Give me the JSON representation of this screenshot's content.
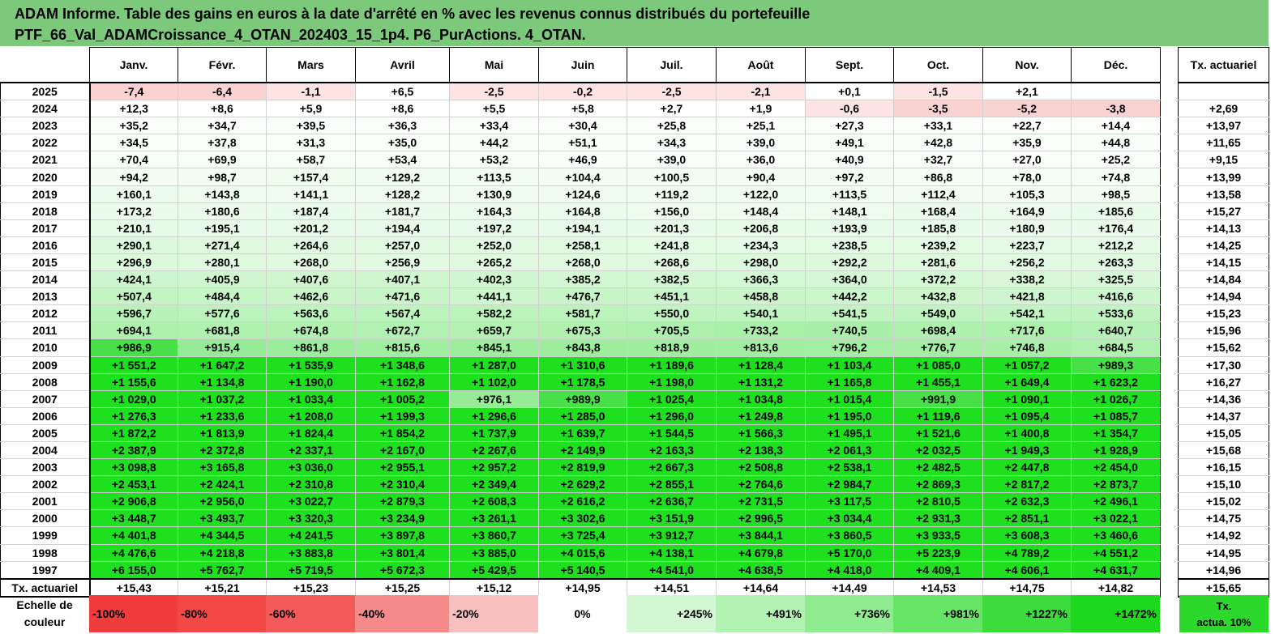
{
  "title": {
    "line1": "ADAM Informe. Table des gains en euros à la date d'arrêté en % avec les revenus connus distribués du portefeuille",
    "line2": "PTF_66_Val_ADAMCroissance_4_OTAN_202403_15_1p4. P6_PurActions. 4_OTAN."
  },
  "months": [
    "Janv.",
    "Févr.",
    "Mars",
    "Avril",
    "Mai",
    "Juin",
    "Juil.",
    "Août",
    "Sept.",
    "Oct.",
    "Nov.",
    "Déc."
  ],
  "tx_header": "Tx. actuariel",
  "rows": [
    {
      "year": "2025",
      "cells": [
        "-7,4",
        "-6,4",
        "-1,1",
        "+6,5",
        "-2,5",
        "-0,2",
        "-2,5",
        "-2,1",
        "+0,1",
        "-1,5",
        "+2,1",
        ""
      ],
      "tx": ""
    },
    {
      "year": "2024",
      "cells": [
        "+12,3",
        "+8,6",
        "+5,9",
        "+8,6",
        "+5,5",
        "+5,8",
        "+2,7",
        "+1,9",
        "-0,6",
        "-3,5",
        "-5,2",
        "-3,8"
      ],
      "tx": "+2,69"
    },
    {
      "year": "2023",
      "cells": [
        "+35,2",
        "+34,7",
        "+39,5",
        "+36,3",
        "+33,4",
        "+30,4",
        "+25,8",
        "+25,1",
        "+27,3",
        "+33,1",
        "+22,7",
        "+14,4"
      ],
      "tx": "+13,97"
    },
    {
      "year": "2022",
      "cells": [
        "+34,5",
        "+37,8",
        "+31,3",
        "+35,0",
        "+44,2",
        "+51,1",
        "+34,3",
        "+39,0",
        "+49,1",
        "+42,8",
        "+35,9",
        "+44,8"
      ],
      "tx": "+11,65"
    },
    {
      "year": "2021",
      "cells": [
        "+70,4",
        "+69,9",
        "+58,7",
        "+53,4",
        "+53,2",
        "+46,9",
        "+39,0",
        "+36,0",
        "+40,9",
        "+32,7",
        "+27,0",
        "+25,2"
      ],
      "tx": "+9,15"
    },
    {
      "year": "2020",
      "cells": [
        "+94,2",
        "+98,7",
        "+157,4",
        "+129,2",
        "+113,5",
        "+104,4",
        "+100,5",
        "+90,4",
        "+97,2",
        "+86,8",
        "+78,0",
        "+74,8"
      ],
      "tx": "+13,99"
    },
    {
      "year": "2019",
      "cells": [
        "+160,1",
        "+143,8",
        "+141,1",
        "+128,2",
        "+130,9",
        "+124,6",
        "+119,2",
        "+122,0",
        "+113,5",
        "+112,4",
        "+105,3",
        "+98,5"
      ],
      "tx": "+13,58"
    },
    {
      "year": "2018",
      "cells": [
        "+173,2",
        "+180,6",
        "+187,4",
        "+181,7",
        "+164,3",
        "+164,8",
        "+156,0",
        "+148,4",
        "+148,1",
        "+168,4",
        "+164,9",
        "+185,6"
      ],
      "tx": "+15,27"
    },
    {
      "year": "2017",
      "cells": [
        "+210,1",
        "+195,1",
        "+201,2",
        "+194,4",
        "+197,2",
        "+194,1",
        "+201,3",
        "+206,8",
        "+193,9",
        "+185,8",
        "+180,9",
        "+176,4"
      ],
      "tx": "+14,13"
    },
    {
      "year": "2016",
      "cells": [
        "+290,1",
        "+271,4",
        "+264,6",
        "+257,0",
        "+252,0",
        "+258,1",
        "+241,8",
        "+234,3",
        "+238,5",
        "+239,2",
        "+223,7",
        "+212,2"
      ],
      "tx": "+14,25"
    },
    {
      "year": "2015",
      "cells": [
        "+296,9",
        "+280,1",
        "+268,0",
        "+256,9",
        "+265,2",
        "+268,0",
        "+268,6",
        "+298,0",
        "+292,2",
        "+281,6",
        "+256,2",
        "+263,3"
      ],
      "tx": "+14,15"
    },
    {
      "year": "2014",
      "cells": [
        "+424,1",
        "+405,9",
        "+407,6",
        "+407,1",
        "+402,3",
        "+385,2",
        "+382,5",
        "+366,3",
        "+364,0",
        "+372,2",
        "+338,2",
        "+325,5"
      ],
      "tx": "+14,84"
    },
    {
      "year": "2013",
      "cells": [
        "+507,4",
        "+484,4",
        "+462,6",
        "+471,6",
        "+441,1",
        "+476,7",
        "+451,1",
        "+458,8",
        "+442,2",
        "+432,8",
        "+421,8",
        "+416,6"
      ],
      "tx": "+14,94"
    },
    {
      "year": "2012",
      "cells": [
        "+596,7",
        "+577,6",
        "+563,6",
        "+567,4",
        "+582,2",
        "+581,7",
        "+550,0",
        "+540,1",
        "+541,5",
        "+549,0",
        "+542,1",
        "+533,6"
      ],
      "tx": "+15,23"
    },
    {
      "year": "2011",
      "cells": [
        "+694,1",
        "+681,8",
        "+674,8",
        "+672,7",
        "+659,7",
        "+675,3",
        "+705,5",
        "+733,2",
        "+740,5",
        "+698,4",
        "+717,6",
        "+640,7"
      ],
      "tx": "+15,96"
    },
    {
      "year": "2010",
      "cells": [
        "+986,9",
        "+915,4",
        "+861,8",
        "+815,6",
        "+845,1",
        "+843,8",
        "+818,9",
        "+813,6",
        "+796,2",
        "+776,7",
        "+746,8",
        "+684,5"
      ],
      "tx": "+15,62"
    },
    {
      "year": "2009",
      "cells": [
        "+1 551,2",
        "+1 647,2",
        "+1 535,9",
        "+1 348,6",
        "+1 287,0",
        "+1 310,6",
        "+1 189,6",
        "+1 128,4",
        "+1 103,4",
        "+1 085,0",
        "+1 057,2",
        "+989,3"
      ],
      "tx": "+17,30"
    },
    {
      "year": "2008",
      "cells": [
        "+1 155,6",
        "+1 134,8",
        "+1 190,0",
        "+1 162,8",
        "+1 102,0",
        "+1 178,5",
        "+1 198,0",
        "+1 131,2",
        "+1 165,8",
        "+1 455,1",
        "+1 649,4",
        "+1 623,2"
      ],
      "tx": "+16,27"
    },
    {
      "year": "2007",
      "cells": [
        "+1 029,0",
        "+1 037,2",
        "+1 033,4",
        "+1 005,2",
        "+976,1",
        "+989,9",
        "+1 025,4",
        "+1 034,8",
        "+1 015,4",
        "+991,9",
        "+1 090,1",
        "+1 026,7"
      ],
      "tx": "+14,36"
    },
    {
      "year": "2006",
      "cells": [
        "+1 276,3",
        "+1 233,6",
        "+1 208,0",
        "+1 199,3",
        "+1 296,6",
        "+1 285,0",
        "+1 296,0",
        "+1 249,8",
        "+1 195,0",
        "+1 119,6",
        "+1 095,4",
        "+1 085,7"
      ],
      "tx": "+14,37"
    },
    {
      "year": "2005",
      "cells": [
        "+1 872,2",
        "+1 813,9",
        "+1 824,4",
        "+1 854,2",
        "+1 737,9",
        "+1 639,7",
        "+1 544,5",
        "+1 566,3",
        "+1 495,1",
        "+1 521,6",
        "+1 400,8",
        "+1 354,7"
      ],
      "tx": "+15,05"
    },
    {
      "year": "2004",
      "cells": [
        "+2 387,9",
        "+2 372,8",
        "+2 337,1",
        "+2 167,0",
        "+2 267,6",
        "+2 149,9",
        "+2 163,3",
        "+2 138,3",
        "+2 061,3",
        "+2 032,5",
        "+1 949,3",
        "+1 928,9"
      ],
      "tx": "+15,68"
    },
    {
      "year": "2003",
      "cells": [
        "+3 098,8",
        "+3 165,8",
        "+3 036,0",
        "+2 955,1",
        "+2 957,2",
        "+2 819,9",
        "+2 667,3",
        "+2 508,8",
        "+2 538,1",
        "+2 482,5",
        "+2 447,8",
        "+2 454,0"
      ],
      "tx": "+16,15"
    },
    {
      "year": "2002",
      "cells": [
        "+2 453,1",
        "+2 424,1",
        "+2 310,8",
        "+2 310,4",
        "+2 349,4",
        "+2 629,2",
        "+2 855,1",
        "+2 764,6",
        "+2 984,7",
        "+2 869,3",
        "+2 817,2",
        "+2 873,7"
      ],
      "tx": "+15,10"
    },
    {
      "year": "2001",
      "cells": [
        "+2 906,8",
        "+2 956,0",
        "+3 022,7",
        "+2 879,3",
        "+2 608,3",
        "+2 616,2",
        "+2 636,7",
        "+2 731,5",
        "+3 117,5",
        "+2 810,5",
        "+2 632,3",
        "+2 496,1"
      ],
      "tx": "+15,02"
    },
    {
      "year": "2000",
      "cells": [
        "+3 448,7",
        "+3 493,7",
        "+3 320,3",
        "+3 234,9",
        "+3 261,1",
        "+3 302,6",
        "+3 151,9",
        "+2 996,5",
        "+3 034,4",
        "+2 931,3",
        "+2 851,1",
        "+3 022,1"
      ],
      "tx": "+14,75"
    },
    {
      "year": "1999",
      "cells": [
        "+4 401,8",
        "+4 344,5",
        "+4 241,5",
        "+3 897,8",
        "+3 860,7",
        "+3 725,4",
        "+3 912,7",
        "+3 844,1",
        "+3 860,5",
        "+3 933,5",
        "+3 608,3",
        "+3 460,6"
      ],
      "tx": "+14,92"
    },
    {
      "year": "1998",
      "cells": [
        "+4 476,6",
        "+4 218,8",
        "+3 883,8",
        "+3 801,4",
        "+3 885,0",
        "+4 015,6",
        "+4 138,1",
        "+4 679,8",
        "+5 170,0",
        "+5 223,9",
        "+4 789,2",
        "+4 551,2"
      ],
      "tx": "+14,95"
    },
    {
      "year": "1997",
      "cells": [
        "+6 155,0",
        "+5 762,7",
        "+5 719,5",
        "+5 672,3",
        "+5 429,5",
        "+5 140,5",
        "+4 541,0",
        "+4 638,5",
        "+4 418,0",
        "+4 409,1",
        "+4 606,1",
        "+4 631,7"
      ],
      "tx": "+14,96"
    }
  ],
  "actuarial_row": {
    "label": "Tx. actuariel",
    "cells": [
      "+15,43",
      "+15,21",
      "+15,23",
      "+15,25",
      "+15,12",
      "+14,95",
      "+14,51",
      "+14,64",
      "+14,49",
      "+14,53",
      "+14,75",
      "+14,82"
    ],
    "tx": "+15,65"
  },
  "scale": {
    "label_line1": "Echelle de",
    "label_line2": "couleur",
    "steps": [
      {
        "label": "-100%",
        "color": "#f03c3c",
        "align": "left"
      },
      {
        "label": "-80%",
        "color": "#f24848",
        "align": "left"
      },
      {
        "label": "-60%",
        "color": "#f45a5a",
        "align": "left"
      },
      {
        "label": "-40%",
        "color": "#f58a8a",
        "align": "left"
      },
      {
        "label": "-20%",
        "color": "#f9c0c0",
        "align": "left"
      },
      {
        "label": "0%",
        "color": "#ffffff",
        "align": "center"
      },
      {
        "label": "+245%",
        "color": "#d2f7d2",
        "align": "right"
      },
      {
        "label": "+491%",
        "color": "#b2f2b2",
        "align": "right"
      },
      {
        "label": "+736%",
        "color": "#90ec90",
        "align": "right"
      },
      {
        "label": "+981%",
        "color": "#66e466",
        "align": "right"
      },
      {
        "label": "+1227%",
        "color": "#3cdc3c",
        "align": "right"
      },
      {
        "label": "+1472%",
        "color": "#1ed81e",
        "align": "right"
      }
    ],
    "tx_line1": "Tx.",
    "tx_line2": "actua. 10%",
    "tx_color": "#2bd82b"
  },
  "colors": {
    "title_bg": "#7cc97c",
    "neg_light": "#fde3e3",
    "neg_strong": "#fbd2d2"
  }
}
